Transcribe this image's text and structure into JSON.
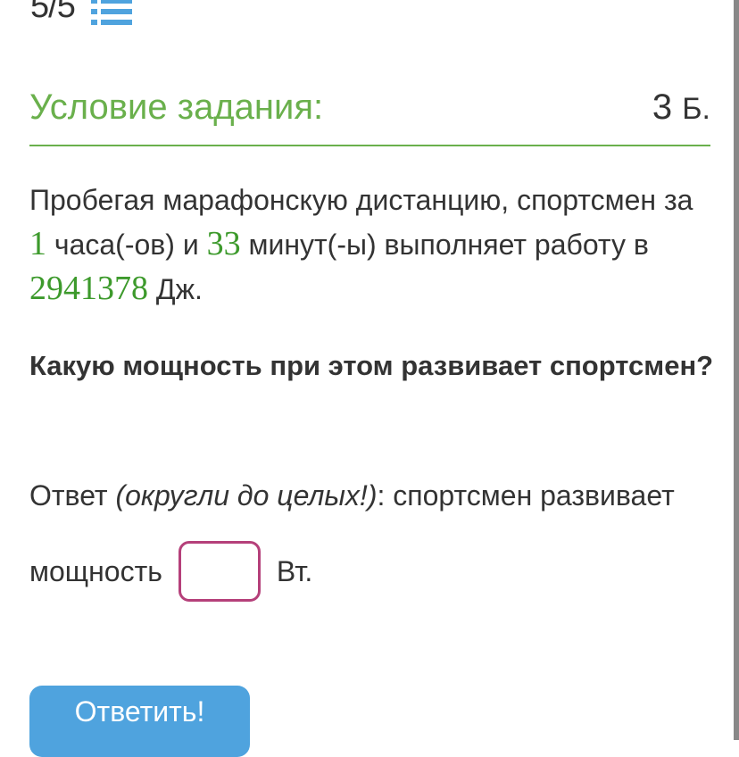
{
  "progress": {
    "counter": "5/5"
  },
  "task": {
    "heading": "Условие задания:",
    "points_value": "3",
    "points_unit": "Б."
  },
  "statement": {
    "part1": "Пробегая марафонскую дистанцию, спортсмен за ",
    "hours": "1",
    "part2": " часа(-ов) и ",
    "minutes": "33",
    "part3": " минут(-ы) выполняет работу в ",
    "work": "2941378",
    "part4": " Дж."
  },
  "question": "Какую мощность при этом развивает спортсмен?",
  "answer": {
    "prefix": "Ответ ",
    "hint": "(округли до целых!)",
    "suffix": ": спортсмен развивает",
    "label": "мощность",
    "value": "",
    "unit": "Вт."
  },
  "submit_label": "Ответить!",
  "colors": {
    "accent_green": "#6ab04c",
    "number_green": "#3d9a2c",
    "button_blue": "#4fa3de",
    "input_border": "#b5407a"
  },
  "icons": {
    "task_list": "list-icon"
  }
}
